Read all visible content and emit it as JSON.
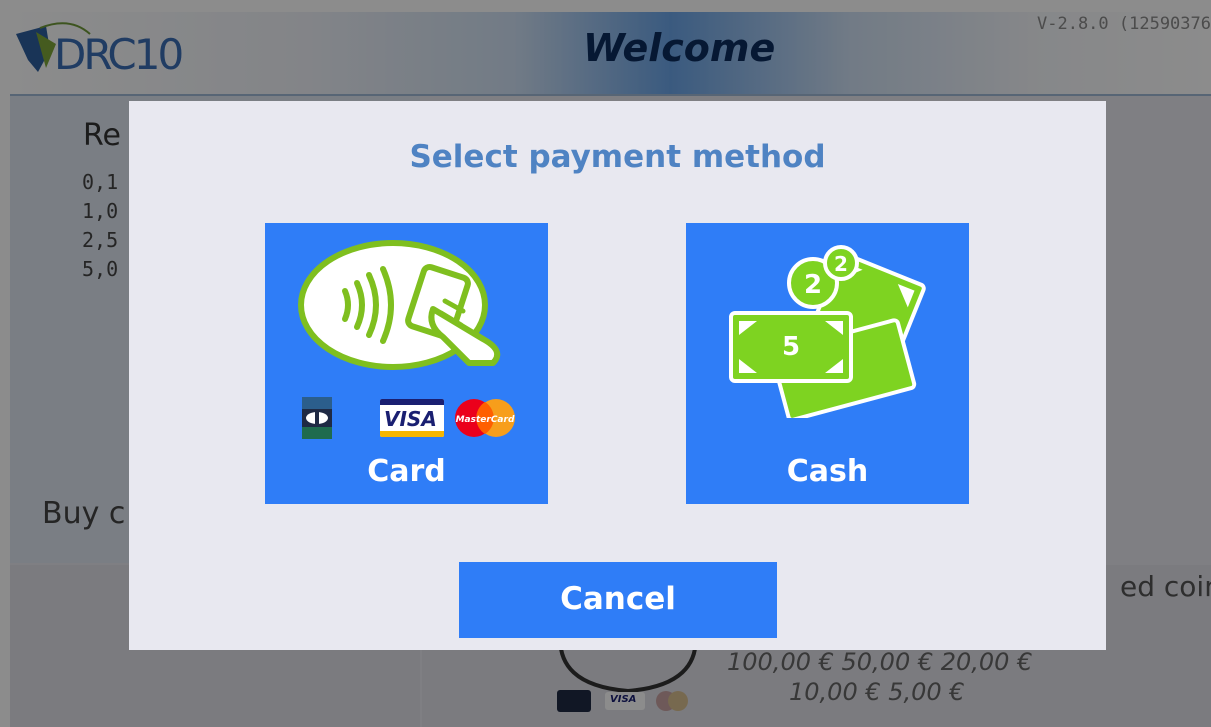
{
  "header": {
    "logo_text": "DRC10",
    "title": "Welcome",
    "version": "V-2.8.0 (12590376"
  },
  "background": {
    "rates_title": "Re",
    "rates": [
      "0,1",
      "1,0",
      "2,5",
      "5,0"
    ],
    "buy_text": "Buy c",
    "accepted_coins": "ed coins",
    "notes_line1": "100,00 € 50,00 € 20,00 €",
    "notes_line2": "10,00 € 5,00 €"
  },
  "dialog": {
    "title": "Select payment method",
    "options": [
      {
        "label": "Card",
        "icon": "contactless-card-icon",
        "logos": [
          "CB",
          "VISA",
          "MasterCard"
        ]
      },
      {
        "label": "Cash",
        "icon": "cash-banknotes-icon",
        "note_value": "5",
        "coin_values": [
          "2",
          "2"
        ]
      }
    ],
    "cancel_label": "Cancel"
  },
  "colors": {
    "accent": "#2f7df7",
    "title": "#4f83c3",
    "dialog_bg": "#e8e8f0",
    "icon_green": "#7fbf1f",
    "cash_green": "#7ed321"
  }
}
